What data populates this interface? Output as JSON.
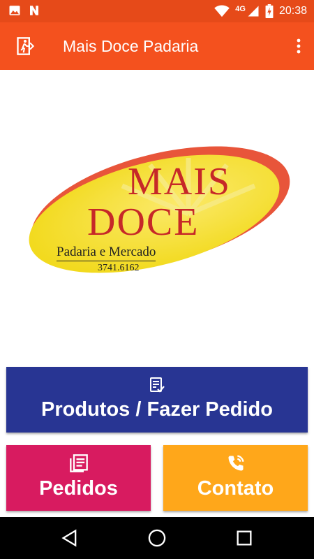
{
  "status_bar": {
    "time": "20:38",
    "network": "4G",
    "icons": [
      "image-icon",
      "n-icon",
      "wifi-icon",
      "signal-icon",
      "battery-charging-icon"
    ]
  },
  "toolbar": {
    "title": "Mais Doce Padaria",
    "left_icon": "exit-door-icon",
    "right_icon": "overflow-menu-icon"
  },
  "logo": {
    "line1": "MAIS",
    "line2": "DOCE",
    "subtitle": "Padaria e Mercado",
    "phone": "3741.6162"
  },
  "buttons": {
    "produtos": {
      "label": "Produtos / Fazer Pedido",
      "icon": "order-list-icon"
    },
    "pedidos": {
      "label": "Pedidos",
      "icon": "orders-icon"
    },
    "contato": {
      "label": "Contato",
      "icon": "phone-icon"
    }
  },
  "navigation": {
    "items": [
      "back-icon",
      "home-icon",
      "recents-icon"
    ]
  },
  "colors": {
    "status_bar": "#e64a19",
    "toolbar": "#f4511e",
    "produtos": "#283593",
    "pedidos": "#d81b60",
    "contato": "#ffa71a",
    "logo_red": "#c62828",
    "logo_yellow": "#f4e12f"
  }
}
